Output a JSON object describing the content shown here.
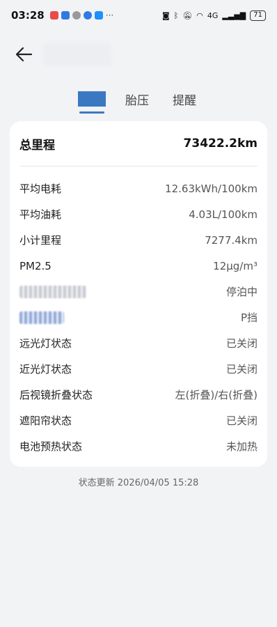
{
  "status_bar": {
    "time": "03:28",
    "notif_colors": [
      "#e94a4a",
      "#2f7be5",
      "#888888",
      "#2f7be5",
      "#1e90ff"
    ],
    "more": "···",
    "signal_text": "4G",
    "battery": "71"
  },
  "header": {
    "back_icon": "arrow-left-icon"
  },
  "tabs": {
    "items": [
      "胎压",
      "提醒"
    ],
    "accent": "#3a78c2"
  },
  "card": {
    "total_label": "总里程",
    "total_value": "73422.2km",
    "rows": [
      {
        "label": "平均电耗",
        "value": "12.63kWh/100km"
      },
      {
        "label": "平均油耗",
        "value": "4.03L/100km"
      },
      {
        "label": "小计里程",
        "value": "7277.4km"
      },
      {
        "label": "PM2.5",
        "value": "12μg/m³"
      },
      {
        "label": "",
        "value": "停泊中"
      },
      {
        "label": "",
        "value": "P挡"
      },
      {
        "label": "远光灯状态",
        "value": "已关闭"
      },
      {
        "label": "近光灯状态",
        "value": "已关闭"
      },
      {
        "label": "后视镜折叠状态",
        "value": "左(折叠)/右(折叠)"
      },
      {
        "label": "遮阳帘状态",
        "value": "已关闭"
      },
      {
        "label": "电池预热状态",
        "value": "未加热"
      }
    ]
  },
  "footer": {
    "update_text": "状态更新 2026/04/05 15:28"
  }
}
